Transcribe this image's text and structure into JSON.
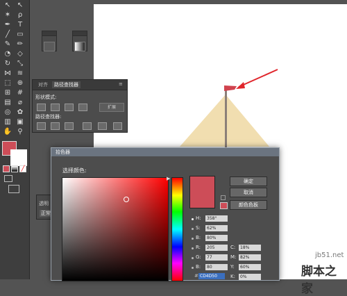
{
  "pathfinder": {
    "tabs": [
      "对齐",
      "路径查找器"
    ],
    "shape_modes_label": "形状模式:",
    "expand_label": "扩展",
    "pathfinders_label": "路径查找器:"
  },
  "transparency": {
    "tab": "透明",
    "mode": "正常"
  },
  "color_picker": {
    "title": "拾色器",
    "prompt": "选择颜色:",
    "buttons": {
      "ok": "确定",
      "cancel": "取消",
      "swatches": "颜色色板"
    },
    "hsb": [
      {
        "label": "H:",
        "value": "358°",
        "selected": true
      },
      {
        "label": "S:",
        "value": "62%",
        "selected": false
      },
      {
        "label": "B:",
        "value": "80%",
        "selected": false
      }
    ],
    "rgb": [
      {
        "label": "R:",
        "value": "205"
      },
      {
        "label": "G:",
        "value": "77"
      },
      {
        "label": "B:",
        "value": "80"
      }
    ],
    "cmyk": [
      {
        "label": "C:",
        "value": "18%"
      },
      {
        "label": "M:",
        "value": "82%"
      },
      {
        "label": "Y:",
        "value": "60%"
      },
      {
        "label": "K:",
        "value": "0%"
      }
    ],
    "hex_value": "CD4D50",
    "selected_color": "#cd4d58"
  },
  "fill_color": "#cd4d58",
  "illustration": {
    "flag_color": "#d0434e",
    "sail_color": "#f1deb0",
    "arrow_color": "#e0262c"
  },
  "watermark": {
    "site": "jb51.net",
    "brand": "脚本之家"
  }
}
